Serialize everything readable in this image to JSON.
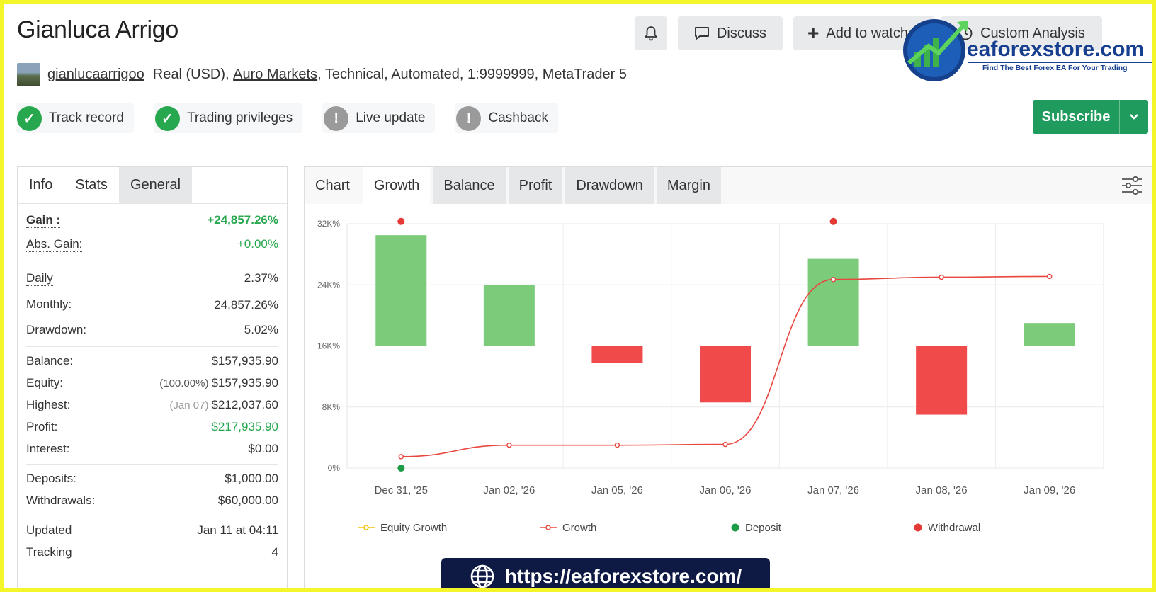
{
  "header": {
    "title": "Gianluca Arrigo",
    "username": "gianlucaarrigoo",
    "account_prefix": "Real (USD),",
    "broker": "Auro Markets",
    "account_suffix": ", Technical, Automated, 1:9999999, MetaTrader 5",
    "discuss_label": "Discuss",
    "add_watch_label": "Add to watch",
    "custom_analysis_label": "Custom Analysis"
  },
  "badges": [
    {
      "label": "Track record",
      "status": "check"
    },
    {
      "label": "Trading privileges",
      "status": "check"
    },
    {
      "label": "Live update",
      "status": "exclamation"
    },
    {
      "label": "Cashback",
      "status": "exclamation"
    }
  ],
  "subscribe": {
    "label": "Subscribe"
  },
  "left_tabs": [
    "Info",
    "Stats",
    "General"
  ],
  "stats": {
    "gain_label": "Gain :",
    "gain_value": "+24,857.26%",
    "abs_gain_label": "Abs. Gain:",
    "abs_gain_value": "+0.00%",
    "daily_label": "Daily",
    "daily_value": "2.37%",
    "monthly_label": "Monthly:",
    "monthly_value": "24,857.26%",
    "drawdown_label": "Drawdown:",
    "drawdown_value": "5.02%",
    "balance_label": "Balance:",
    "balance_value": "$157,935.90",
    "equity_label": "Equity:",
    "equity_pct": "(100.00%)",
    "equity_value": "$157,935.90",
    "highest_label": "Highest:",
    "highest_date": "(Jan 07)",
    "highest_value": "$212,037.60",
    "profit_label": "Profit:",
    "profit_value": "$217,935.90",
    "interest_label": "Interest:",
    "interest_value": "$0.00",
    "deposits_label": "Deposits:",
    "deposits_value": "$1,000.00",
    "withdrawals_label": "Withdrawals:",
    "withdrawals_value": "$60,000.00",
    "updated_label": "Updated",
    "updated_value": "Jan 11 at 04:11",
    "tracking_label": "Tracking",
    "tracking_value": "4"
  },
  "chart_tabs": [
    "Chart",
    "Growth",
    "Balance",
    "Profit",
    "Drawdown",
    "Margin"
  ],
  "chart_data": {
    "type": "bar",
    "categories": [
      "Dec 31, '25",
      "Jan 02, '26",
      "Jan 05, '26",
      "Jan 06, '26",
      "Jan 07, '26",
      "Jan 08, '26",
      "Jan 09, '26"
    ],
    "y_ticks": [
      "0%",
      "8K%",
      "16K%",
      "24K%",
      "32K%"
    ],
    "ylim": [
      0,
      32000
    ],
    "bar_baseline": 16000,
    "bars": [
      30500,
      24000,
      13800,
      8600,
      27400,
      7000,
      19000
    ],
    "growth_line": [
      1500,
      3000,
      3000,
      3100,
      24700,
      25000,
      25100
    ],
    "withdrawal_points": [
      {
        "x": "Dec 31, '25",
        "y": 32300
      },
      {
        "x": "Jan 07, '26",
        "y": 32300
      }
    ],
    "deposit_points": [
      {
        "x": "Dec 31, '25",
        "y": 0
      }
    ],
    "legend": [
      {
        "name": "Equity Growth",
        "color": "#f2c200"
      },
      {
        "name": "Growth",
        "color": "#e8473f"
      },
      {
        "name": "Deposit",
        "color": "#1e9b47"
      },
      {
        "name": "Withdrawal",
        "color": "#e53935"
      }
    ],
    "colors": {
      "positive": "#7ccb7a",
      "negative": "#f04a4a",
      "line": "#e8473f"
    }
  },
  "watermark": {
    "brand": "eaforexstore.com",
    "tagline": "Find The Best Forex EA For Your Trading"
  },
  "url_bar": {
    "text": "https://eaforexstore.com/"
  }
}
